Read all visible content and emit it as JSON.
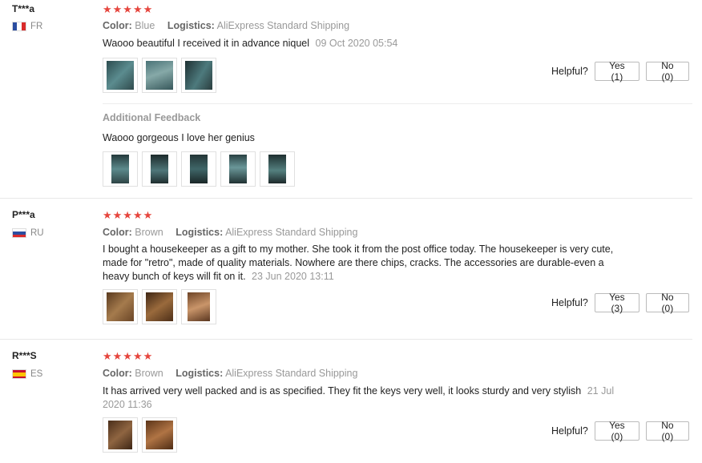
{
  "reviews": [
    {
      "user": "T***a",
      "country": "FR",
      "stars": "★★★★★",
      "color_label": "Color:",
      "color_value": "Blue",
      "logistics_label": "Logistics:",
      "logistics_value": "AliExpress Standard Shipping",
      "text": "Waooo beautiful I received it in advance niquel",
      "date": "09 Oct 2020 05:54",
      "helpful_label": "Helpful?",
      "yes_label": "Yes (1)",
      "no_label": "No (0)",
      "additional_feedback_title": "Additional Feedback",
      "additional_feedback_text": "Waooo gorgeous I love her genius"
    },
    {
      "user": "P***a",
      "country": "RU",
      "stars": "★★★★★",
      "color_label": "Color:",
      "color_value": "Brown",
      "logistics_label": "Logistics:",
      "logistics_value": "AliExpress Standard Shipping",
      "text": "I bought a housekeeper as a gift to my mother. She took it from the post office today. The housekeeper is very cute, made for \"retro\", made of quality materials. Nowhere are there chips, cracks. The accessories are durable-even a heavy bunch of keys will fit on it.",
      "date": "23 Jun 2020 13:11",
      "helpful_label": "Helpful?",
      "yes_label": "Yes (3)",
      "no_label": "No (0)"
    },
    {
      "user": "R***S",
      "country": "ES",
      "stars": "★★★★★",
      "color_label": "Color:",
      "color_value": "Brown",
      "logistics_label": "Logistics:",
      "logistics_value": "AliExpress Standard Shipping",
      "text": "It has arrived very well packed and is as specified. They fit the keys very well, it looks sturdy and very stylish",
      "date": "21 Jul 2020 11:36",
      "helpful_label": "Helpful?",
      "yes_label": "Yes (0)",
      "no_label": "No (0)"
    }
  ],
  "colors": {
    "star": "#e6453d",
    "photo_blue": "#3f6f73",
    "photo_brown": "#7a4e2d"
  }
}
